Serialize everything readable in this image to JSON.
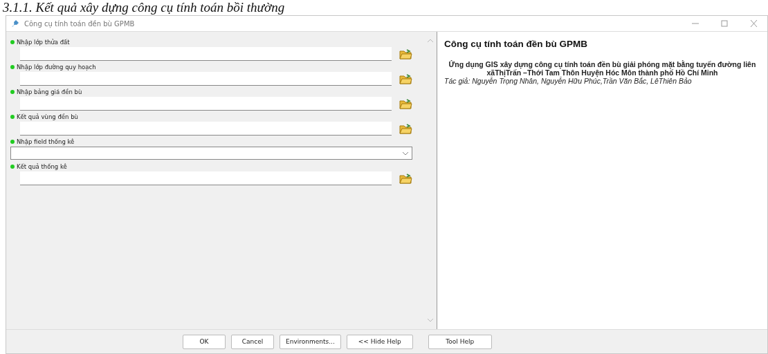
{
  "document_heading": "3.1.1. Kết quả xây dựng công cụ tính toán bồi thường",
  "window": {
    "title": "Công cụ tính toán đền bù GPMB"
  },
  "parameters": [
    {
      "label": "Nhập lớp thửa đất",
      "kind": "file"
    },
    {
      "label": "Nhập lớp đường quy hoạch",
      "kind": "file"
    },
    {
      "label": "Nhập bảng giá đền bù",
      "kind": "file"
    },
    {
      "label": "Kết quả vùng đền bù",
      "kind": "file"
    },
    {
      "label": "Nhập field thống kê",
      "kind": "dropdown"
    },
    {
      "label": "Kết quả thống kê",
      "kind": "file"
    }
  ],
  "help": {
    "title": "Công cụ tính toán đền bù GPMB",
    "description": "Ứng dụng GIS xây dựng công cụ tính toán đền bù giải phóng mặt bằng tuyến đường liên xãThịTrấn –Thới Tam Thôn Huyện Hóc Môn thành phố Hồ Chí Minh",
    "author": "Tác giả: Nguyễn Trọng Nhân, Nguyễn Hữu Phúc,Trần Văn Bắc, LêThiên Bảo"
  },
  "buttons": [
    "OK",
    "Cancel",
    "Environments...",
    "<< Hide Help",
    "Tool Help"
  ]
}
